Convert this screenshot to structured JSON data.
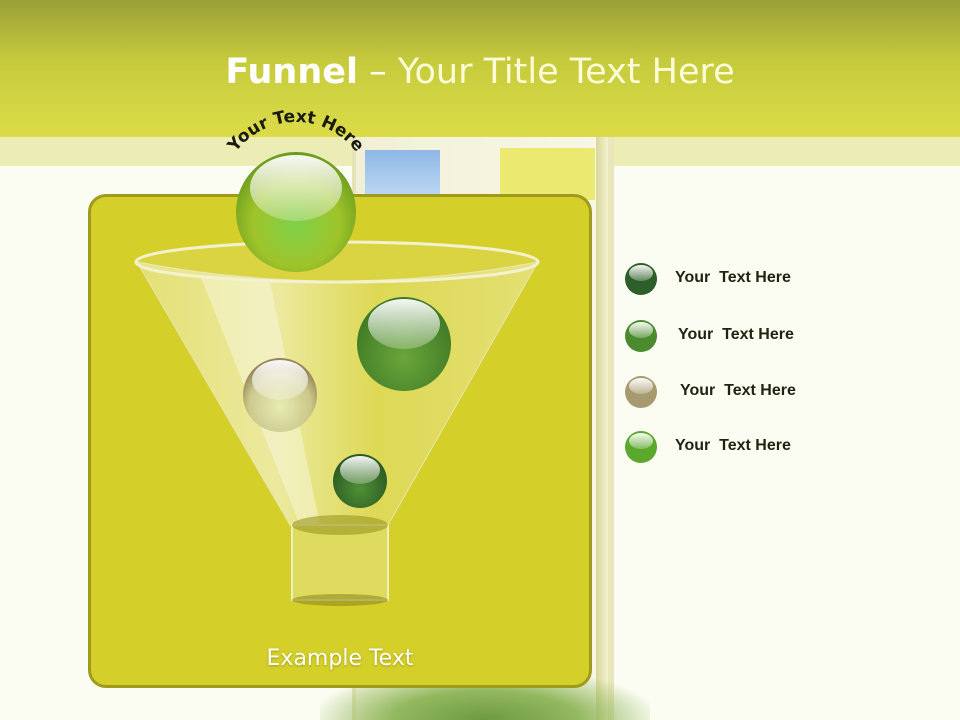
{
  "title": {
    "bold": "Funnel",
    "separator": " – ",
    "rest": "Your Title Text Here"
  },
  "arc_label": "Your Text Here",
  "panel_caption": "Example Text",
  "legend": [
    {
      "label": "Your  Text Here",
      "color": "#2e5e2a"
    },
    {
      "label": "Your  Text Here",
      "color": "#4c8a2e"
    },
    {
      "label": "Your  Text Here",
      "color": "#a89a70"
    },
    {
      "label": "Your  Text Here",
      "color": "#5aa82c"
    }
  ],
  "colors": {
    "panel": "#d5cf2a",
    "header": "#c6cb3c",
    "accent_green": "#3aa33a"
  }
}
